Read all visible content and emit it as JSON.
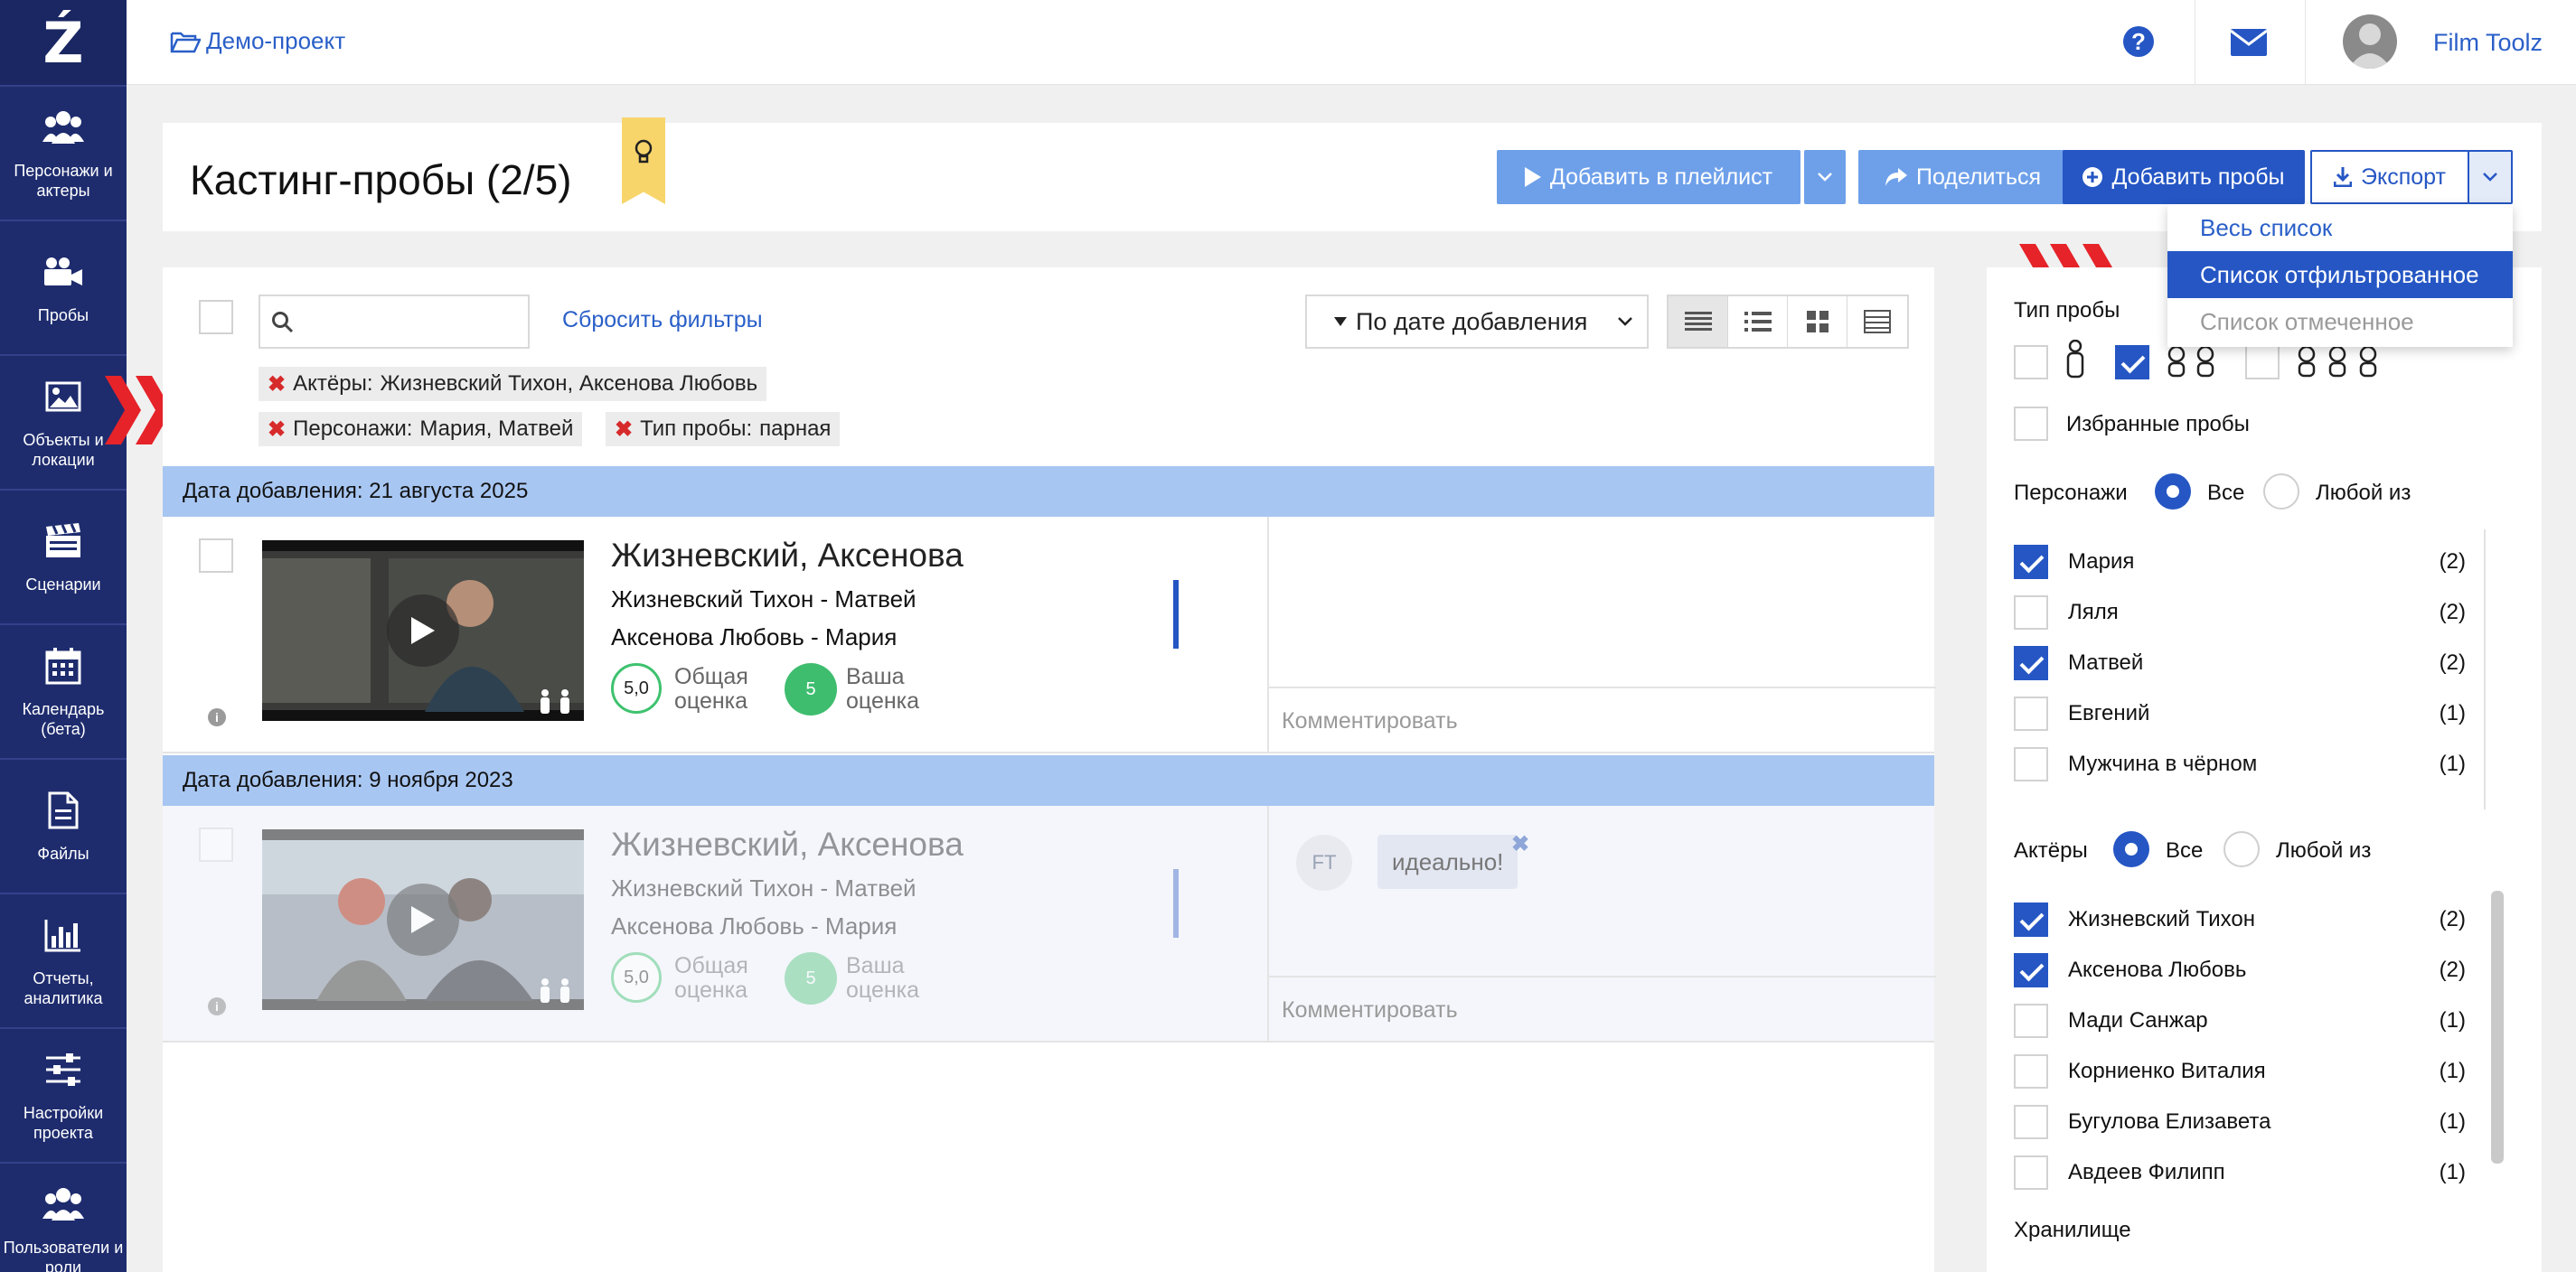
{
  "sidebar": {
    "logo": "Ź",
    "items": [
      {
        "label": "Персонажи и\nактеры",
        "icon": "people-icon"
      },
      {
        "label": "Пробы",
        "icon": "video-camera-icon"
      },
      {
        "label": "Объекты и\nлокации",
        "icon": "image-icon"
      },
      {
        "label": "Сценарии",
        "icon": "clapperboard-icon"
      },
      {
        "label": "Календарь\n(бета)",
        "icon": "calendar-icon"
      },
      {
        "label": "Файлы",
        "icon": "file-icon"
      },
      {
        "label": "Отчеты,\nаналитика",
        "icon": "bar-chart-icon"
      },
      {
        "label": "Настройки\nпроекта",
        "icon": "sliders-icon"
      },
      {
        "label": "Пользователи и\nроли",
        "icon": "users-icon"
      }
    ]
  },
  "topbar": {
    "project": "Демо-проект",
    "username": "Film Toolz"
  },
  "header": {
    "title": "Кастинг-пробы (2/5)",
    "add_playlist": "Добавить в плейлист",
    "share": "Поделиться",
    "add_tests": "Добавить пробы",
    "export": "Экспорт"
  },
  "export_menu": [
    "Весь список",
    "Список отфильтрованное",
    "Список отмеченное"
  ],
  "toolbar": {
    "reset": "Сбросить фильтры",
    "sort": "По дате добавления"
  },
  "chips": [
    {
      "key": "Актёры:",
      "value": "Жизневский Тихон, Аксенова Любовь"
    },
    {
      "key": "Персонажи:",
      "value": "Мария, Матвей"
    },
    {
      "key": "Тип пробы:",
      "value": "парная"
    }
  ],
  "groups": [
    {
      "date_label": "Дата добавления: 21 августа 2025",
      "title": "Жизневский, Аксенова",
      "line1": "Жизневский Тихон - Матвей",
      "line2": "Аксенова Любовь - Мария",
      "overall": "5,0",
      "overall_label": "Общая\nоценка",
      "yours": "5",
      "yours_label": "Ваша\nоценка",
      "comment_placeholder": "Комментировать"
    },
    {
      "date_label": "Дата добавления: 9 ноября 2023",
      "title": "Жизневский, Аксенова",
      "line1": "Жизневский Тихон - Матвей",
      "line2": "Аксенова Любовь - Мария",
      "overall": "5,0",
      "overall_label": "Общая\nоценка",
      "yours": "5",
      "yours_label": "Ваша\nоценка",
      "comment_initials": "FT",
      "comment_text": "идеально!",
      "comment_placeholder": "Комментировать"
    }
  ],
  "filters": {
    "test_type_label": "Тип пробы",
    "favorites": "Избранные пробы",
    "characters": {
      "title": "Персонажи",
      "all": "Все",
      "any": "Любой из",
      "items": [
        {
          "name": "Мария",
          "count": "(2)",
          "checked": true
        },
        {
          "name": "Ляля",
          "count": "(2)",
          "checked": false
        },
        {
          "name": "Матвей",
          "count": "(2)",
          "checked": true
        },
        {
          "name": "Евгений",
          "count": "(1)",
          "checked": false
        },
        {
          "name": "Мужчина в чёрном",
          "count": "(1)",
          "checked": false
        }
      ]
    },
    "actors": {
      "title": "Актёры",
      "all": "Все",
      "any": "Любой из",
      "items": [
        {
          "name": "Жизневский Тихон",
          "count": "(2)",
          "checked": true
        },
        {
          "name": "Аксенова Любовь",
          "count": "(2)",
          "checked": true
        },
        {
          "name": "Мади Санжар",
          "count": "(1)",
          "checked": false
        },
        {
          "name": "Корниенко Виталия",
          "count": "(1)",
          "checked": false
        },
        {
          "name": "Бугулова Елизавета",
          "count": "(1)",
          "checked": false
        },
        {
          "name": "Авдеев Филипп",
          "count": "(1)",
          "checked": false
        }
      ]
    },
    "storage": "Хранилище"
  },
  "colors": {
    "sidebar": "#1e2c6e",
    "accent": "#2556c4",
    "light_button": "#6ea0ea",
    "date_bar": "#a8c6f2",
    "green": "#3ebd6e",
    "arrow": "#e52329"
  }
}
